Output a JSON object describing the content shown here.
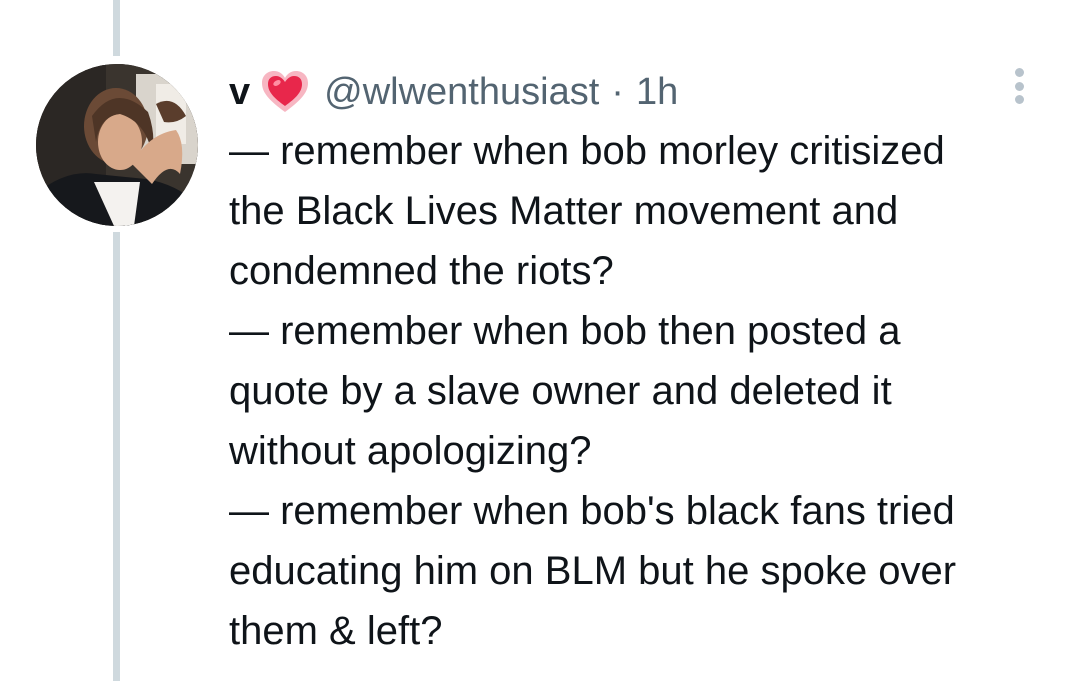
{
  "tweet": {
    "display_name": "v",
    "emoji_icon": "sparkling-heart-icon",
    "handle": "@wlwenthusiast",
    "separator": "·",
    "timestamp": "1h",
    "more_icon": "more-options-icon",
    "paragraphs": [
      "— remember when bob morley critisized\nthe Black Lives Matter movement and\ncondemned the riots?",
      "— remember when bob then posted a\nquote by a slave owner and deleted it\nwithout apologizing?",
      "— remember when bob's black fans tried\neducating him on BLM but he spoke over\nthem & left?"
    ]
  },
  "colors": {
    "text": "#0f1419",
    "secondary_text": "#536471",
    "thread_line": "#cfd9de",
    "heart": "#e8274b"
  }
}
